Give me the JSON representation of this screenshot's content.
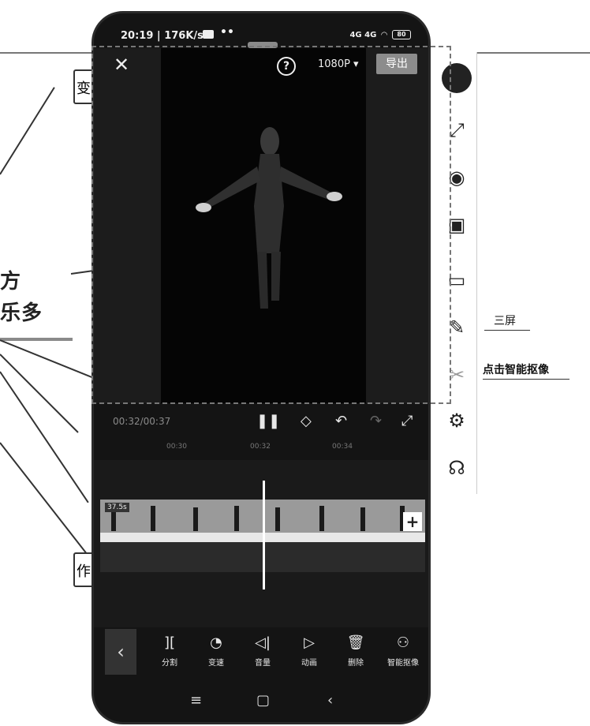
{
  "background": {
    "mindmap_text_1": "方",
    "mindmap_text_2": "乐多",
    "box_1": "变",
    "box_2": "作",
    "right_label_1": "三屏",
    "right_label_2": "点击智能抠像"
  },
  "status_bar": {
    "time": "20:19",
    "speed": "176K/s",
    "dots": "••",
    "signal": "4G 4G",
    "battery": "80"
  },
  "editor": {
    "close_icon": "close-icon",
    "help_label": "?",
    "resolution": "1080P ▾",
    "export_label": "导出",
    "timecode": "00:32/00:37",
    "ruler_ticks": [
      "00:30",
      "00:32",
      "00:34"
    ],
    "clip_duration": "37.5s",
    "add_label": "+"
  },
  "tools": [
    {
      "icon": "split-icon",
      "glyph": "][",
      "label": "分割"
    },
    {
      "icon": "speed-icon",
      "glyph": "◔",
      "label": "变速"
    },
    {
      "icon": "volume-icon",
      "glyph": "◁|",
      "label": "音量"
    },
    {
      "icon": "animation-icon",
      "glyph": "▷",
      "label": "动画"
    },
    {
      "icon": "delete-icon",
      "glyph": "🗑",
      "label": "删除"
    },
    {
      "icon": "smart-cutout-icon",
      "glyph": "⚇",
      "label": "智能抠像"
    }
  ],
  "nav": {
    "menu": "≡",
    "home": "▢",
    "back": "‹"
  },
  "colors": {
    "phone_bg": "#141414",
    "export_button": "#8c8c8c",
    "track": "#9a9a9a"
  }
}
